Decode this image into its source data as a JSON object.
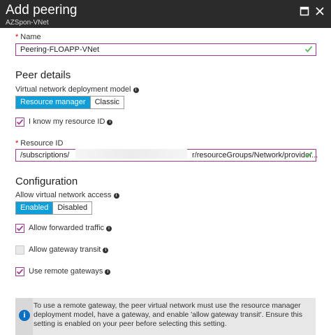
{
  "header": {
    "title": "Add peering",
    "subtitle": "AZSpon-VNet"
  },
  "name": {
    "label": "Name",
    "value": "Peering-FLOAPP-VNet"
  },
  "peer_details": {
    "title": "Peer details",
    "deployment_label": "Virtual network deployment model",
    "options": [
      "Resource manager",
      "Classic"
    ],
    "selected": "Resource manager",
    "know_id_label": "I know my resource ID",
    "know_id_checked": true,
    "resource_label": "Resource ID",
    "resource_value_start": "/subscriptions/",
    "resource_value_end": "r/resourceGroups/Network/provider..."
  },
  "configuration": {
    "title": "Configuration",
    "access_label": "Allow virtual network access",
    "access_options": [
      "Enabled",
      "Disabled"
    ],
    "access_selected": "Enabled",
    "forwarded_label": "Allow forwarded traffic",
    "forwarded_checked": true,
    "gateway_transit_label": "Allow gateway transit",
    "gateway_transit_checked": false,
    "remote_gateways_label": "Use remote gateways",
    "remote_gateways_checked": true
  },
  "notice": {
    "text": "To use a remote gateway, the peer virtual network must use the resource manager deployment model, have a gateway, and enable 'allow gateway transit'. Ensure this setting is enabled on your peer before selecting this setting."
  },
  "icons": {
    "info": "info-icon",
    "check": "check-icon",
    "maximize": "maximize-icon",
    "close": "close-icon"
  },
  "colors": {
    "header_bg": "#2b2b2b",
    "accent": "#0e9fdb",
    "input_border": "#9b3d8f",
    "valid": "#5cb85c",
    "notice_icon": "#0e70c0"
  }
}
